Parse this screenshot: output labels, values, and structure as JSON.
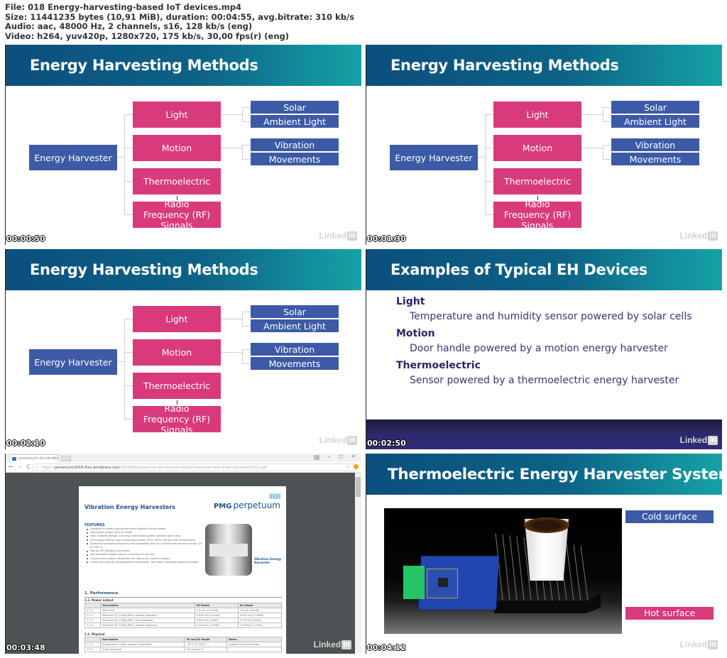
{
  "file_info": {
    "line1": "File: 018 Energy-harvesting-based IoT devices.mp4",
    "line2": "Size: 11441235 bytes (10,91 MiB), duration: 00:04:55, avg.bitrate: 310 kb/s",
    "line3": "Audio: aac, 48000 Hz, 2 channels, s16, 128 kb/s (eng)",
    "line4": "Video: h264, yuv420p, 1280x720, 175 kb/s, 30,00 fps(r) (eng)"
  },
  "watermark": {
    "text": "Linked",
    "badge": "in"
  },
  "colors": {
    "header_start": "#0b4f7e",
    "header_end": "#15a2a6",
    "node_blue": "#3c5aa6",
    "node_pink": "#d93a7c"
  },
  "diagram": {
    "title": "Energy Harvesting Methods",
    "root": "Energy Harvester",
    "methods": [
      "Light",
      "Motion",
      "Thermoelectric",
      "Radio Frequency (RF) Signals"
    ],
    "light_sources": [
      "Solar",
      "Ambient Light"
    ],
    "motion_sources": [
      "Vibration",
      "Movements"
    ]
  },
  "frames": [
    {
      "timestamp": "00:00:50"
    },
    {
      "timestamp": "00:01:30"
    },
    {
      "timestamp": "00:02:10"
    },
    {
      "timestamp": "00:02:50"
    },
    {
      "timestamp": "00:03:48"
    },
    {
      "timestamp": "00:04:12"
    }
  ],
  "examples": {
    "title": "Examples of Typical EH Devices",
    "items": [
      {
        "heading": "Light",
        "desc": "Temperature and humidity sensor powered by solar cells"
      },
      {
        "heading": "Motion",
        "desc": "Door handle powered by a motion energy harvester"
      },
      {
        "heading": "Thermoelectric",
        "desc": "Sensor powered by a thermoelectric energy harvester"
      }
    ]
  },
  "browser": {
    "tab_title": "perpetuum-ltd-vibration",
    "tab_close": "×",
    "url_prefix": "https://",
    "url_host": "perpetuum2016.files.wordpress.com",
    "url_path": "/2016/09/perpetuum-ltd-vibration-energy-harvester-data-sheet-21october2013.pdf",
    "nav": {
      "back": "←",
      "forward": "→",
      "reload": "C",
      "info": "ⓘ"
    },
    "window": {
      "minimize": "–",
      "restore": "◻",
      "close": "×"
    },
    "star": "☆"
  },
  "pdf": {
    "title": "Vibration Energy Harvesters",
    "brand_bold": "PMG",
    "brand": "perpetuum",
    "brand_bars": "||||||||||||",
    "features_heading": "FEATURES",
    "features": [
      "Designed to power high performance Wireless Sensor Nodes.",
      "High power output up to 27.5mW.",
      "High reliability design, including hermetically-sealed stainless steel case.",
      "Intrinsically Safe for use in Hazardous Areas: ATEX, IECEx, FM and cFM Certifications.",
      "Stabilized harvesting frequency and bandwidth over full industrial temperature range -40 to +85 °C.",
      "Two-pin IEC-standard connector.",
      "Two standard voltage outputs, nominally 5V and 8V.",
      "Current drive output independent of load up to nominal voltage.",
      "Center thru-hole for straightforward installation, with other mounting options available."
    ],
    "device_caption": "Vibration Energy Harvester",
    "section": "1. Performance",
    "power_output": {
      "heading": "1.1. Power output",
      "columns": [
        "",
        "Description",
        "5V Model",
        "8V Model"
      ],
      "rows": [
        [
          "1.1.1",
          "Maximum",
          "5.5 mA (27.5mW)",
          "3.0 mA (24mW)"
        ],
        [
          "1.1.2",
          "Minimum @ 0.050g RMS, nominal frequency",
          "0.840 mA (4.2mW)",
          "0.525 mA (4.2mW)"
        ],
        [
          "1.1.3",
          "Minimum @ 0.050g RMS, 2Hz bandwidth",
          "0.600 mA (3mW)",
          "0.375 mA (3mW)"
        ],
        [
          "1.1.4",
          "Minimum @ 0.025g RMS, nominal frequency",
          "0.240mA (1.2mW)",
          "0.150mA (1.2mW)"
        ]
      ]
    },
    "physical": {
      "heading": "1.2. Physical",
      "columns": [
        "",
        "Description",
        "5V and 8V Model",
        "Notes"
      ],
      "rows": [
        [
          "1.2.1",
          "Temperature range, storage & operation",
          "-40°C TO +85°C",
          "Applies to all parameters"
        ],
        [
          "1.2.2",
          "Outer envelope",
          "See section 6",
          ""
        ]
      ]
    }
  },
  "thermo": {
    "title": "Thermoelectric Energy Harvester System",
    "cold_label": "Cold surface",
    "hot_label": "Hot surface"
  }
}
